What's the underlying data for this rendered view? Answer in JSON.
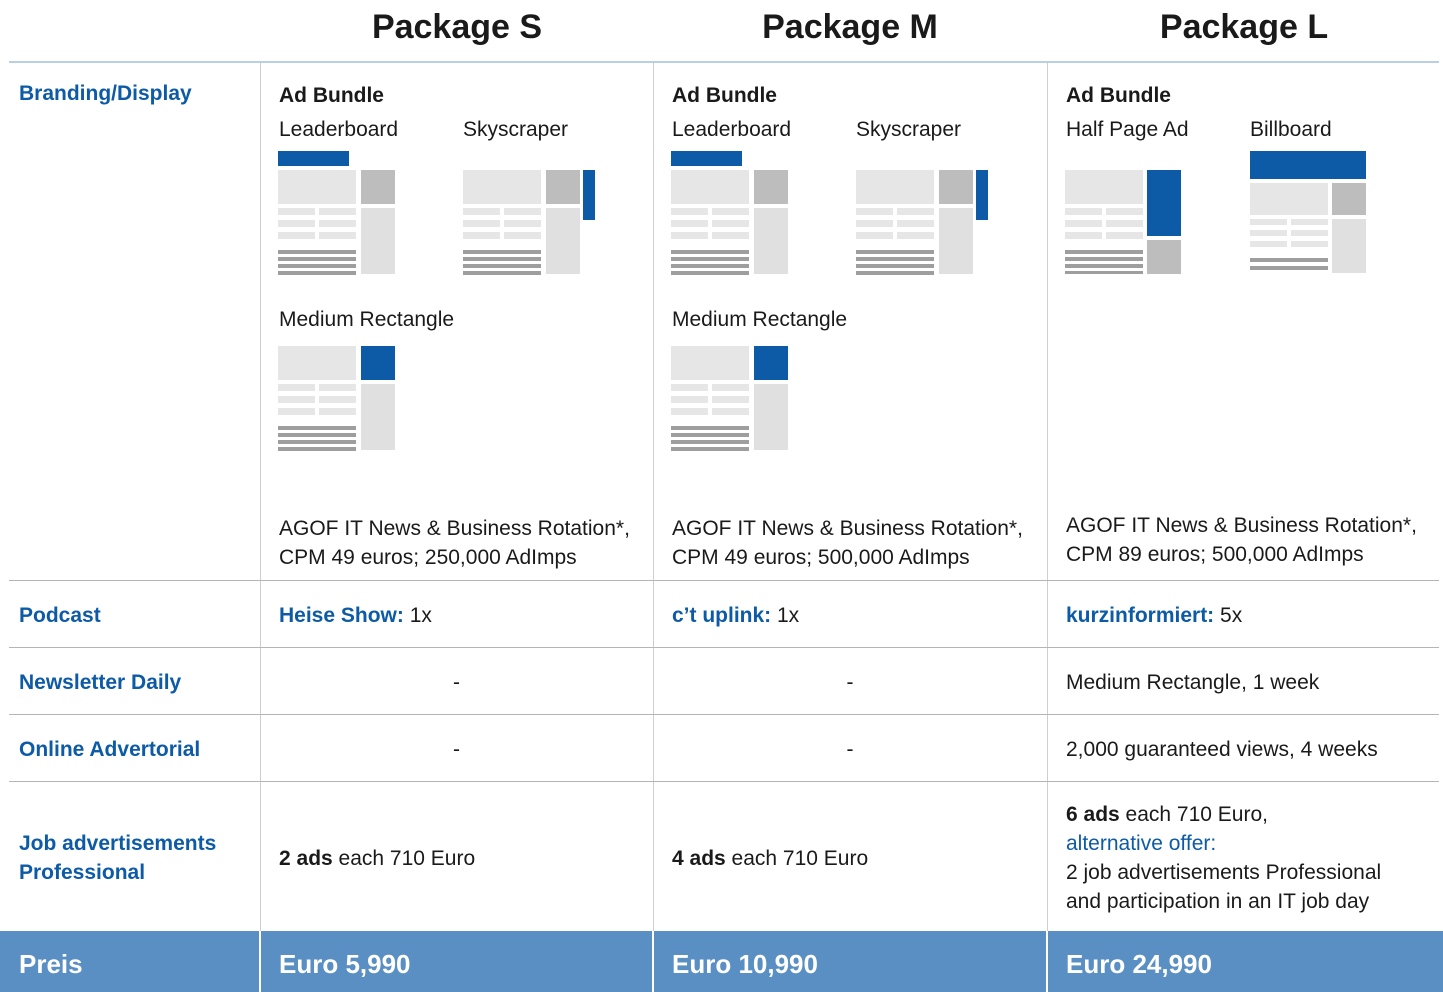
{
  "columns": {
    "header_s": "Package S",
    "header_m": "Package M",
    "header_l": "Package L"
  },
  "rows": {
    "branding": "Branding/Display",
    "podcast": "Podcast",
    "newsletter": "Newsletter Daily",
    "advertorial": "Online Advertorial",
    "jobs": "Job advertisements Professional",
    "price": "Preis"
  },
  "pkg_s": {
    "bundle_title": "Ad Bundle",
    "ad1": "Leaderboard",
    "ad2": "Skyscraper",
    "ad3": "Medium Rectangle",
    "rotation_line1": "AGOF IT News & Business Rotation*,",
    "rotation_line2": "CPM 49 euros; 250,000 AdImps",
    "podcast_name": "Heise Show:",
    "podcast_count": " 1x",
    "newsletter": "-",
    "advertorial": "-",
    "jobs_bold": "2 ads",
    "jobs_rest": " each 710 Euro",
    "price": "Euro 5,990"
  },
  "pkg_m": {
    "bundle_title": "Ad Bundle",
    "ad1": "Leaderboard",
    "ad2": "Skyscraper",
    "ad3": "Medium Rectangle",
    "rotation_line1": "AGOF IT News & Business Rotation*,",
    "rotation_line2": "CPM 49 euros; 500,000 AdImps",
    "podcast_name": "c’t uplink:",
    "podcast_count": " 1x",
    "newsletter": "-",
    "advertorial": "-",
    "jobs_bold": "4 ads",
    "jobs_rest": " each 710 Euro",
    "price": "Euro 10,990"
  },
  "pkg_l": {
    "bundle_title": "Ad Bundle",
    "ad1": "Half Page Ad",
    "ad2": "Billboard",
    "rotation_line1": "AGOF IT News & Business Rotation*,",
    "rotation_line2": "CPM 89 euros; 500,000 AdImps",
    "podcast_name": "kurzinformiert:",
    "podcast_count": " 5x",
    "newsletter": "Medium Rectangle, 1 week",
    "advertorial": "2,000 guaranteed views, 4 weeks",
    "jobs_bold": "6 ads",
    "jobs_rest": " each 710 Euro,",
    "jobs_alt": "alternative offer:",
    "jobs_alt_line1": "2 job advertisements Professional",
    "jobs_alt_line2": "and participation in an IT job day",
    "price": "Euro 24,990"
  },
  "colors": {
    "accent_blue": "#0d5ba6",
    "footer_blue": "#5a8fc3",
    "thumb_light": "#e6e6e6",
    "thumb_mid": "#bdbdbd",
    "thumb_dark": "#9e9e9e"
  },
  "icons": {
    "leaderboard": "leaderboard-thumbnail-icon",
    "skyscraper": "skyscraper-thumbnail-icon",
    "medium_rectangle": "medium-rectangle-thumbnail-icon",
    "half_page_ad": "half-page-ad-thumbnail-icon",
    "billboard": "billboard-thumbnail-icon"
  }
}
